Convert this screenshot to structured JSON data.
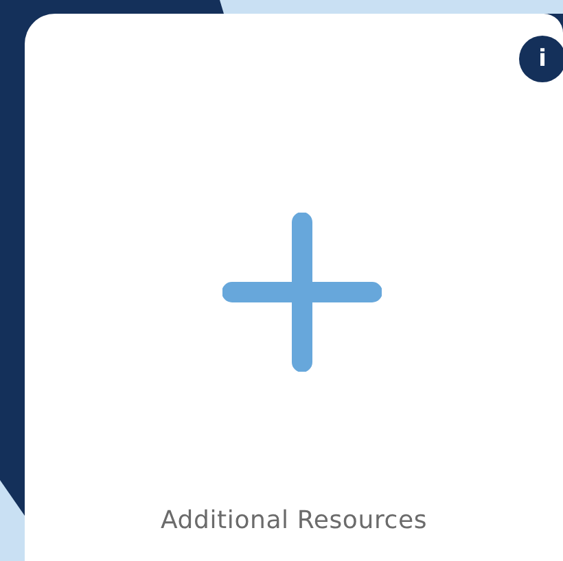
{
  "card": {
    "title": "Additional Resources",
    "info_button": "i"
  }
}
